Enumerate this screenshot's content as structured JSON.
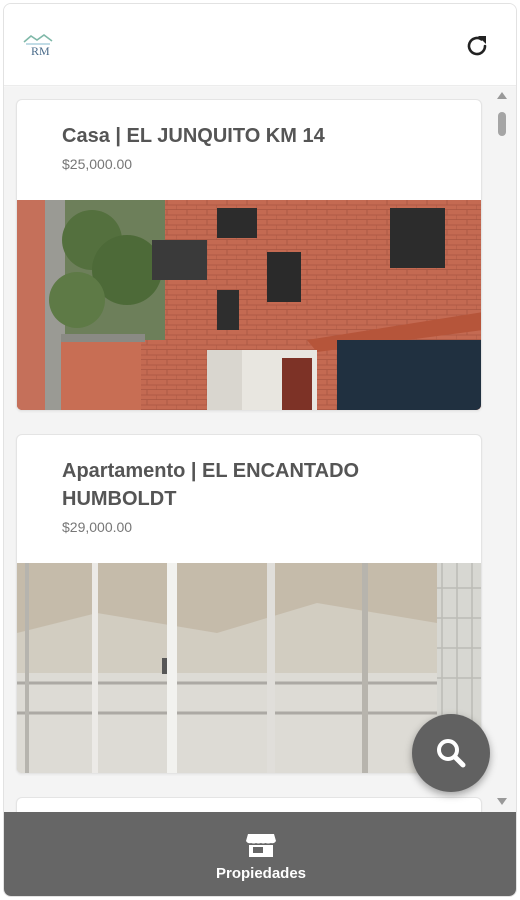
{
  "header": {
    "logo_text": "RM",
    "refresh_icon": "refresh-icon"
  },
  "listings": [
    {
      "title": "Casa | EL JUNQUITO KM 14",
      "price": "$25,000.00",
      "image": "brick-house-photo"
    },
    {
      "title": "Apartamento | EL ENCANTADO HUMBOLDT",
      "price": "$29,000.00",
      "image": "window-view-photo"
    }
  ],
  "fab": {
    "icon": "search-icon"
  },
  "bottom_nav": {
    "tab_label": "Propiedades",
    "tab_icon": "store-icon"
  },
  "colors": {
    "bottom_bar": "#666666",
    "fab": "#616161",
    "title": "#555555",
    "price": "#777777"
  }
}
